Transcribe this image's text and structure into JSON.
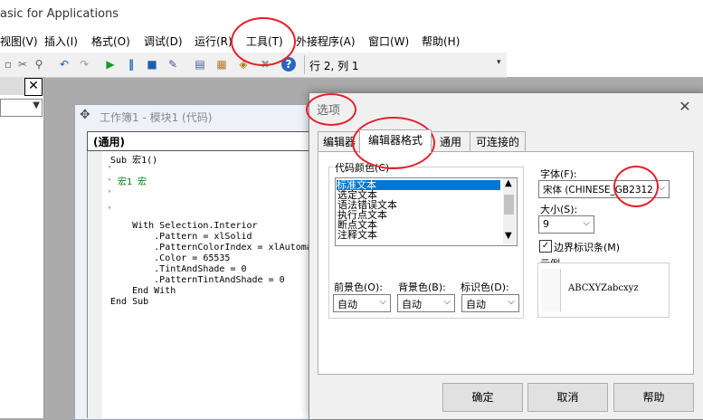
{
  "window": {
    "title": "asic for Applications"
  },
  "menu": [
    "视图(V)",
    "插入(I)",
    "格式(O)",
    "调试(D)",
    "运行(R)",
    "工具(T)",
    "外接程序(A)",
    "窗口(W)",
    "帮助(H)"
  ],
  "toolbar": {
    "position_text": "行 2, 列 1",
    "icons": [
      "copy-icon",
      "find-icon",
      "undo-icon",
      "redo-icon",
      "run-icon",
      "break-icon",
      "reset-icon",
      "design-mode-icon",
      "project-explorer-icon",
      "properties-icon",
      "object-browser-icon",
      "toolbox-icon",
      "help-icon"
    ]
  },
  "project_panel": {
    "close_label": "✕"
  },
  "code_window": {
    "title": "工作簿1 - 模块1 (代码)",
    "object_combo": "(通用)",
    "code_lines": [
      "Sub 宏1()",
      "'",
      "' 宏1 宏",
      "'",
      "",
      "'",
      "    With Selection.Interior",
      "        .Pattern = xlSolid",
      "        .PatternColorIndex = xlAutoma",
      "        .Color = 65535",
      "        .TintAndShade = 0",
      "        .PatternTintAndShade = 0",
      "    End With",
      "End Sub"
    ]
  },
  "dialog": {
    "title": "选项",
    "tabs": [
      "编辑器",
      "编辑器格式",
      "通用",
      "可连接的"
    ],
    "code_colors_label": "代码颜色(C)",
    "code_colors": [
      "标准文本",
      "选定文本",
      "语法错误文本",
      "执行点文本",
      "断点文本",
      "注释文本"
    ],
    "foreground_label": "前景色(O):",
    "background_label": "背景色(B):",
    "indicator_label": "标识色(D):",
    "foreground_value": "自动",
    "background_value": "自动",
    "indicator_value": "自动",
    "font_label": "字体(F):",
    "font_value": "宋体 (CHINESE_GB2312",
    "size_label": "大小(S):",
    "size_value": "9",
    "margin_bar_label": "边界标识条(M)",
    "margin_bar_checked": "✓",
    "sample_label": "示例",
    "sample_text": "ABCXYZabcxyz",
    "ok": "确定",
    "cancel": "取消",
    "help": "帮助"
  },
  "colors": {
    "annotation": "#e4202a",
    "selection": "#0078d7",
    "comment": "#007a00"
  }
}
